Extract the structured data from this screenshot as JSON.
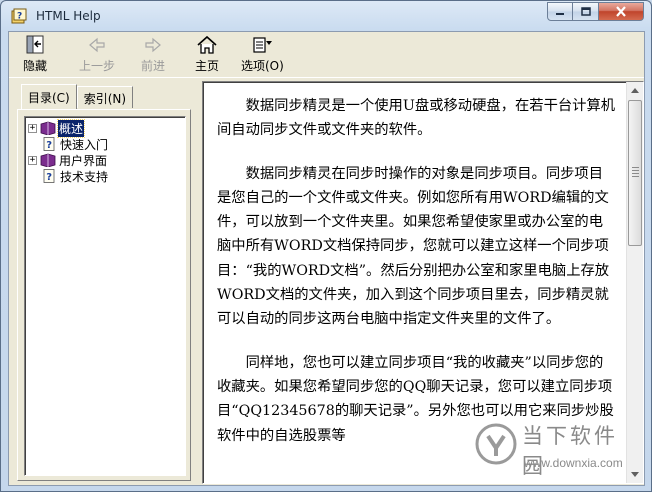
{
  "window": {
    "title": "HTML Help"
  },
  "toolbar": {
    "hide_label": "隐藏",
    "back_label": "上一步",
    "forward_label": "前进",
    "home_label": "主页",
    "options_label": "选项(O)"
  },
  "tabs": [
    {
      "label": "目录(C)",
      "active": true
    },
    {
      "label": "索引(N)",
      "active": false
    }
  ],
  "tree": [
    {
      "label": "概述",
      "type": "book",
      "expander": "+",
      "selected": true
    },
    {
      "label": "快速入门",
      "type": "page",
      "expander": "",
      "selected": false
    },
    {
      "label": "用户界面",
      "type": "book",
      "expander": "+",
      "selected": false
    },
    {
      "label": "技术支持",
      "type": "page",
      "expander": "",
      "selected": false
    }
  ],
  "article": {
    "paragraphs": [
      "数据同步精灵是一个使用U盘或移动硬盘，在若干台计算机间自动同步文件或文件夹的软件。",
      "数据同步精灵在同步时操作的对象是同步项目。同步项目是您自己的一个文件或文件夹。例如您所有用WORD编辑的文件，可以放到一个文件夹里。如果您希望使家里或办公室的电脑中所有WORD文档保持同步，您就可以建立这样一个同步项目：“我的WORD文档”。然后分别把办公室和家里电脑上存放WORD文档的文件夹，加入到这个同步项目里去，同步精灵就可以自动的同步这两台电脑中指定文件夹里的文件了。",
      "同样地，您也可以建立同步项目“我的收藏夹”以同步您的收藏夹。如果您希望同步您的QQ聊天记录，您可以建立同步项目“QQ12345678的聊天记录”。另外您也可以用它来同步炒股软件中的自选股票等"
    ]
  },
  "watermark": {
    "title": "当下软件园",
    "url": "www.downxia.com"
  },
  "colors": {
    "selection": "#0a246a",
    "chrome": "#ece9d8",
    "titlebar": "#c9dbef",
    "close_button": "#c0442c"
  }
}
